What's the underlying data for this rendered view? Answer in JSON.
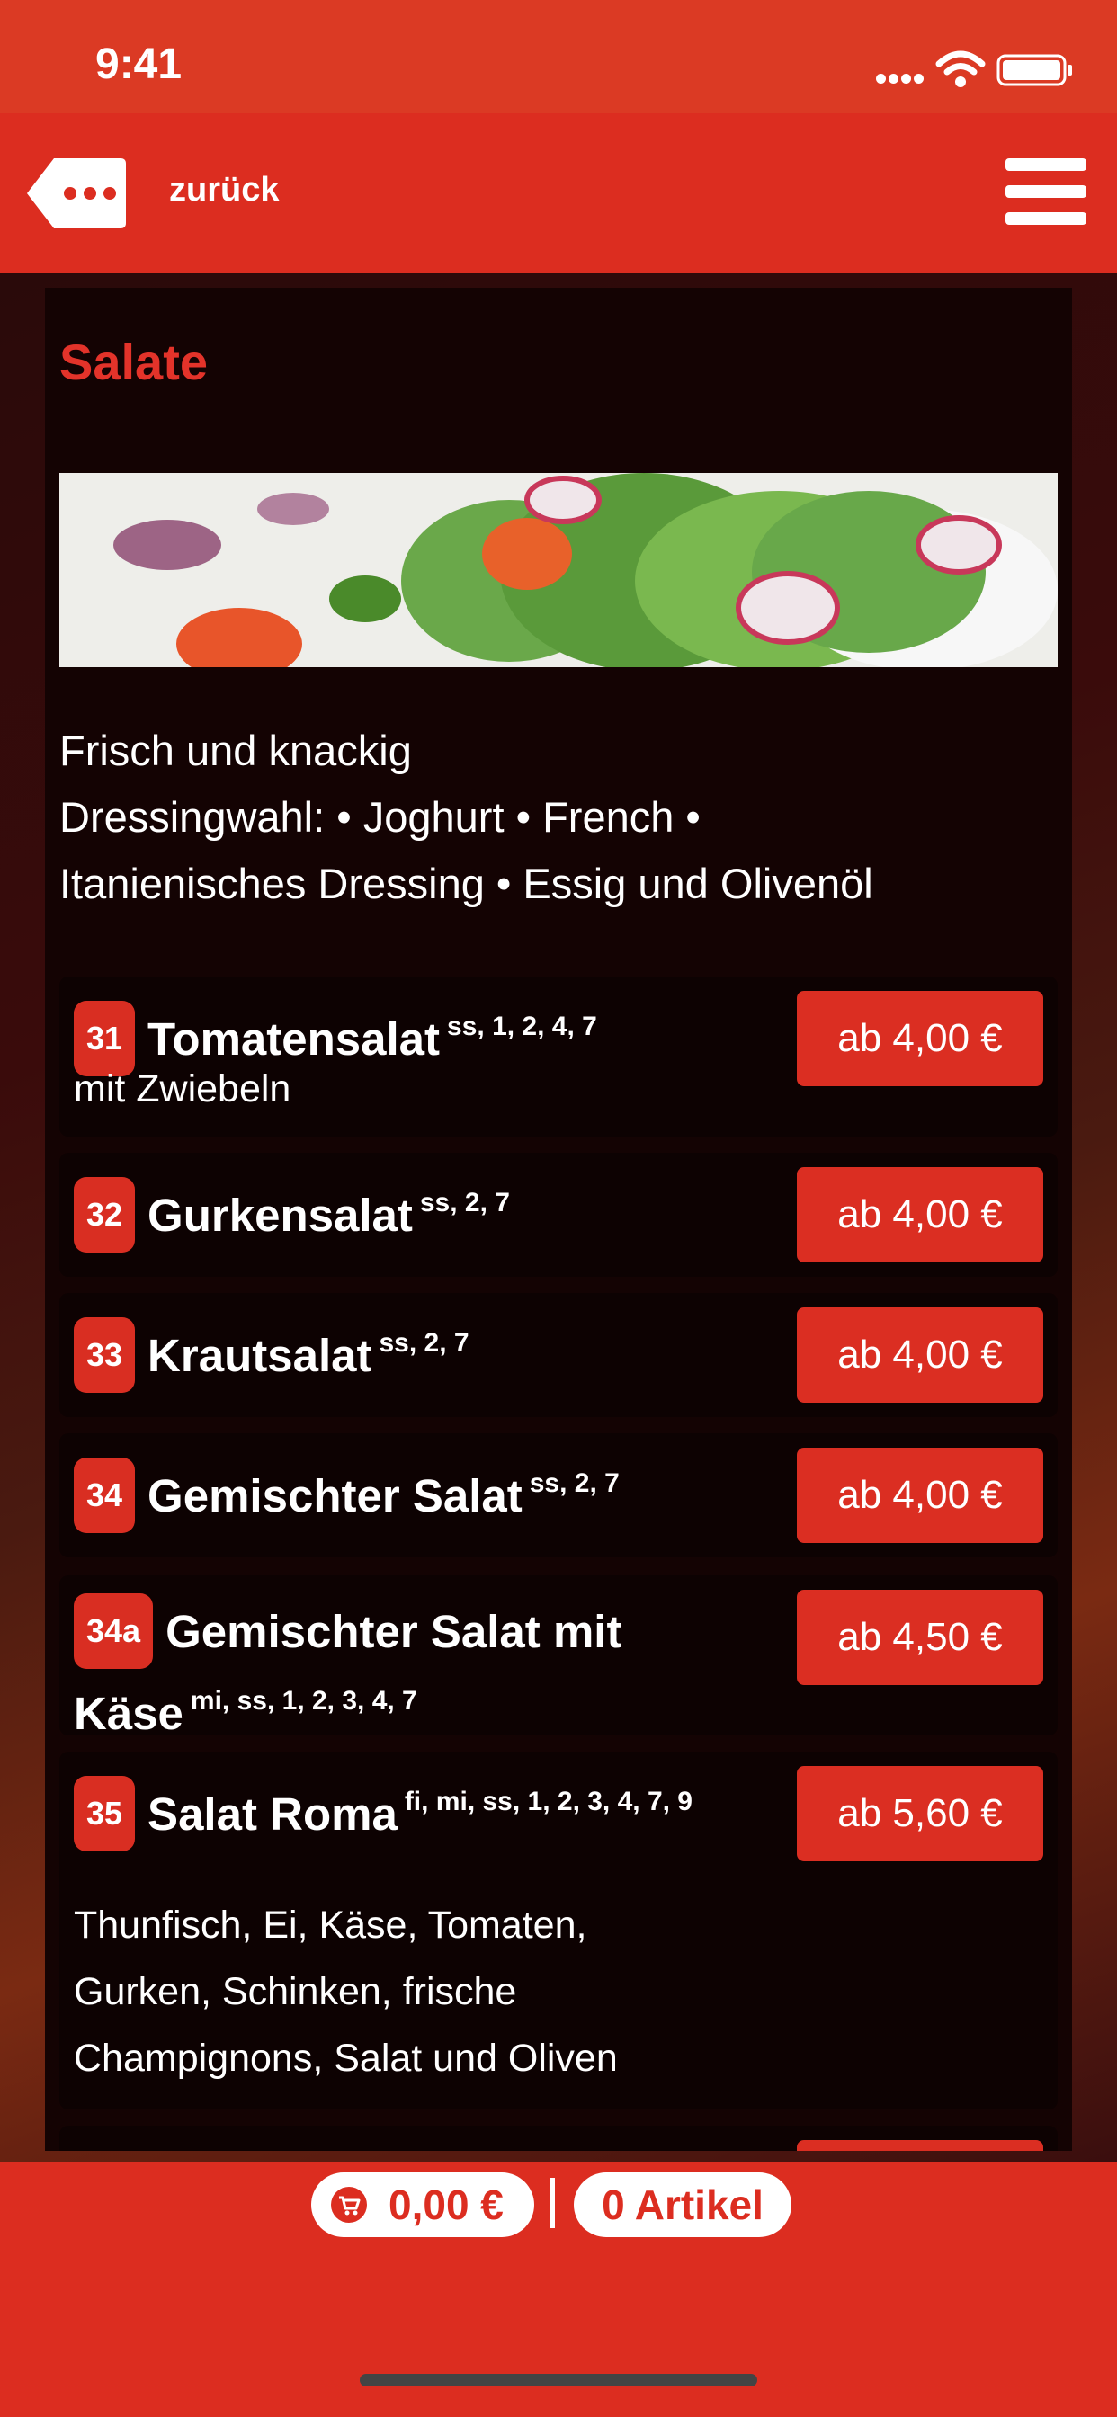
{
  "status_bar": {
    "time": "9:41"
  },
  "nav": {
    "back_label": "zurück"
  },
  "section": {
    "title": "Salate",
    "description": [
      "Frisch und knackig",
      "Dressingwahl: • Joghurt • French •",
      "Itanienisches Dressing • Essig und Olivenöl"
    ]
  },
  "items": [
    {
      "number": "31",
      "name": "Tomatensalat",
      "allergens": "ss, 1, 2, 4, 7",
      "description": "mit Zwiebeln",
      "price": "ab 4,00 €"
    },
    {
      "number": "32",
      "name": "Gurkensalat",
      "allergens": "ss, 2, 7",
      "description": "",
      "price": "ab 4,00 €"
    },
    {
      "number": "33",
      "name": "Krautsalat",
      "allergens": "ss, 2, 7",
      "description": "",
      "price": "ab 4,00 €"
    },
    {
      "number": "34",
      "name": "Gemischter Salat",
      "allergens": "ss, 2, 7",
      "description": "",
      "price": "ab 4,00 €"
    },
    {
      "number": "34a",
      "name": "Gemischter Salat mit Käse",
      "allergens": "mi, ss, 1, 2, 3, 4, 7",
      "description": "",
      "price": "ab 4,50 €"
    },
    {
      "number": "35",
      "name": "Salat Roma",
      "allergens": "fi, mi, ss, 1, 2, 3, 4, 7, 9",
      "description_lines": [
        "Thunfisch, Ei, Käse, Tomaten,",
        "Gurken, Schinken, frische",
        "Champignons, Salat und Oliven"
      ],
      "price": "ab 5,60 €"
    }
  ],
  "cart": {
    "total": "0,00 €",
    "count": "0 Artikel"
  },
  "icons": [
    "signal-icon",
    "wifi-icon",
    "battery-icon",
    "back-icon",
    "menu-icon",
    "cart-icon"
  ],
  "colors": {
    "accent": "#dc2d20",
    "background": "#140303",
    "text": "#ffffff"
  }
}
